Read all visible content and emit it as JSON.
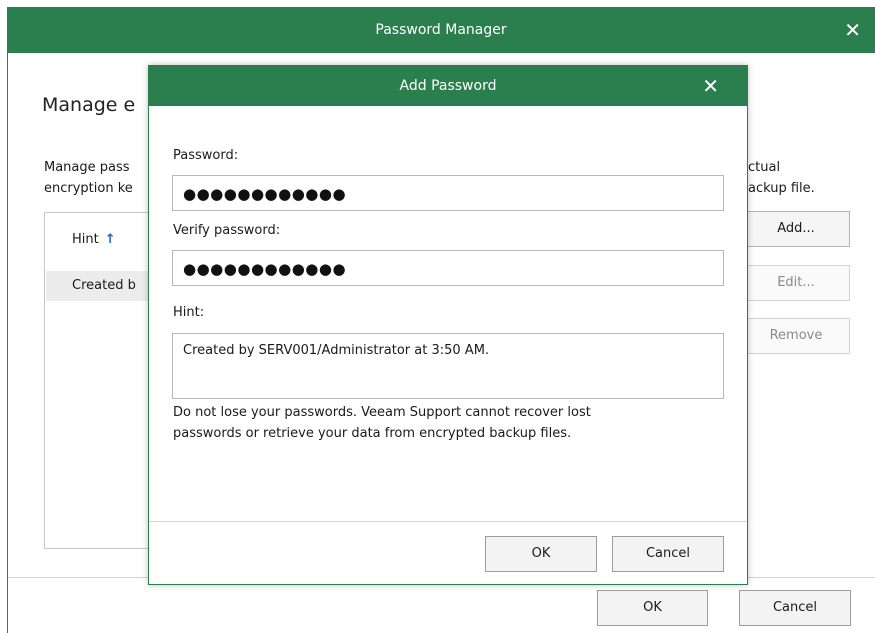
{
  "outer": {
    "title": "Password Manager",
    "close_glyph": "✕",
    "heading": "Manage e",
    "desc_line1": "Manage pass",
    "desc_line2": "encryption ke",
    "desc_right1": "ctual",
    "desc_right2": "ackup file.",
    "grid": {
      "column_header": "Hint",
      "sort_glyph": "↑",
      "row_text": "Created b"
    },
    "buttons": {
      "add": "Add...",
      "edit": "Edit...",
      "remove": "Remove",
      "ok": "OK",
      "cancel": "Cancel"
    }
  },
  "modal": {
    "title": "Add Password",
    "close_glyph": "✕",
    "password_label": "Password:",
    "password_value": "●●●●●●●●●●●●",
    "verify_label": "Verify password:",
    "verify_value": "●●●●●●●●●●●●",
    "hint_label": "Hint:",
    "hint_value": "Created by SERV001/Administrator at 3:50 AM.",
    "warning_line1": "Do not lose your passwords. Veeam Support cannot recover lost",
    "warning_line2": "passwords or retrieve your data from encrypted backup files.",
    "ok": "OK",
    "cancel": "Cancel"
  },
  "colors": {
    "titlebar": "#2b7e4e",
    "sort_arrow": "#1f63c6"
  }
}
